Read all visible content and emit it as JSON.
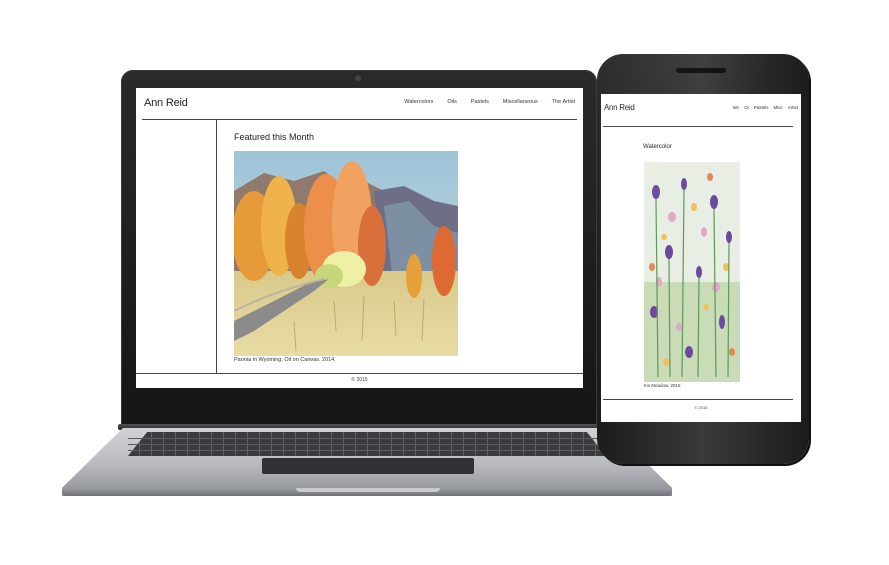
{
  "laptop": {
    "site_title": "Ann Reid",
    "nav": [
      "Watercolors",
      "Oils",
      "Pastels",
      "Miscellaneous",
      "The Artist"
    ],
    "heading": "Featured this Month",
    "painting_caption": "Paonia in Wyoming. Oil on Canvas. 2014.",
    "footer": "© 2015"
  },
  "phone": {
    "site_title": "Ann Reid",
    "nav": [
      "Wc",
      "Oi",
      "Pastels",
      "Misc",
      "Artist"
    ],
    "heading": "Watercolor",
    "painting_caption": "Iris Meadow. 2015",
    "footer": "© 2015"
  },
  "colors": {
    "device_black": "#1c1c1c",
    "laptop_silver": "#b7babf",
    "page_bg": "#ffffff",
    "text": "#222222"
  }
}
